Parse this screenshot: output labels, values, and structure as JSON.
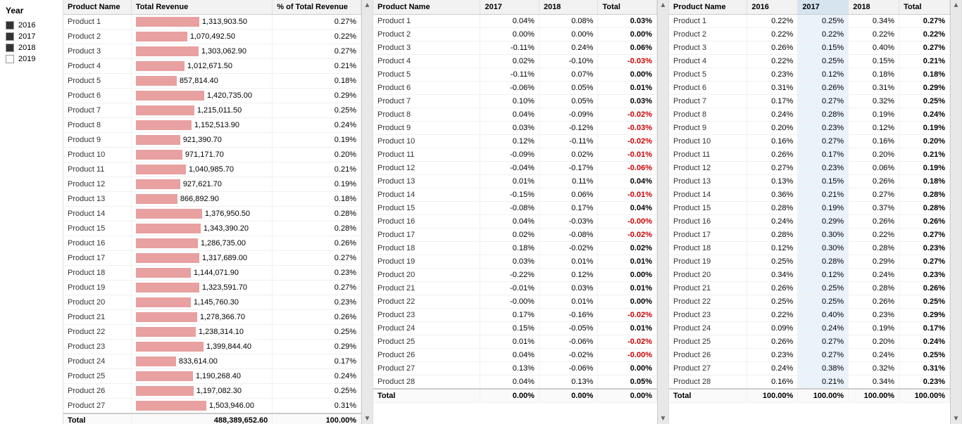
{
  "legend": {
    "title": "Year",
    "items": [
      {
        "label": "2016",
        "filled": true
      },
      {
        "label": "2017",
        "filled": true
      },
      {
        "label": "2018",
        "filled": true
      },
      {
        "label": "2019",
        "filled": false
      }
    ]
  },
  "table1": {
    "headers": [
      "Product Name",
      "Total Revenue",
      "% of Total Revenue"
    ],
    "rows": [
      {
        "name": "Product 1",
        "revenue": "1,313,903.50",
        "pct": "0.27%",
        "barW": 90
      },
      {
        "name": "Product 2",
        "revenue": "1,070,492.50",
        "pct": "0.22%",
        "barW": 73
      },
      {
        "name": "Product 3",
        "revenue": "1,303,062.90",
        "pct": "0.27%",
        "barW": 89
      },
      {
        "name": "Product 4",
        "revenue": "1,012,671.50",
        "pct": "0.21%",
        "barW": 69
      },
      {
        "name": "Product 5",
        "revenue": "857,814.40",
        "pct": "0.18%",
        "barW": 58
      },
      {
        "name": "Product 6",
        "revenue": "1,420,735.00",
        "pct": "0.29%",
        "barW": 97
      },
      {
        "name": "Product 7",
        "revenue": "1,215,011.50",
        "pct": "0.25%",
        "barW": 83
      },
      {
        "name": "Product 8",
        "revenue": "1,152,513.90",
        "pct": "0.24%",
        "barW": 79
      },
      {
        "name": "Product 9",
        "revenue": "921,390.70",
        "pct": "0.19%",
        "barW": 63
      },
      {
        "name": "Product 10",
        "revenue": "971,171.70",
        "pct": "0.20%",
        "barW": 66
      },
      {
        "name": "Product 11",
        "revenue": "1,040,985.70",
        "pct": "0.21%",
        "barW": 71
      },
      {
        "name": "Product 12",
        "revenue": "927,621.70",
        "pct": "0.19%",
        "barW": 63
      },
      {
        "name": "Product 13",
        "revenue": "866,892.90",
        "pct": "0.18%",
        "barW": 59
      },
      {
        "name": "Product 14",
        "revenue": "1,376,950.50",
        "pct": "0.28%",
        "barW": 94
      },
      {
        "name": "Product 15",
        "revenue": "1,343,390.20",
        "pct": "0.28%",
        "barW": 92
      },
      {
        "name": "Product 16",
        "revenue": "1,286,735.00",
        "pct": "0.26%",
        "barW": 88
      },
      {
        "name": "Product 17",
        "revenue": "1,317,689.00",
        "pct": "0.27%",
        "barW": 90
      },
      {
        "name": "Product 18",
        "revenue": "1,144,071.90",
        "pct": "0.23%",
        "barW": 78
      },
      {
        "name": "Product 19",
        "revenue": "1,323,591.70",
        "pct": "0.27%",
        "barW": 90
      },
      {
        "name": "Product 20",
        "revenue": "1,145,760.30",
        "pct": "0.23%",
        "barW": 78
      },
      {
        "name": "Product 21",
        "revenue": "1,278,366.70",
        "pct": "0.26%",
        "barW": 87
      },
      {
        "name": "Product 22",
        "revenue": "1,238,314.10",
        "pct": "0.25%",
        "barW": 85
      },
      {
        "name": "Product 23",
        "revenue": "1,399,844.40",
        "pct": "0.29%",
        "barW": 96
      },
      {
        "name": "Product 24",
        "revenue": "833,614.00",
        "pct": "0.17%",
        "barW": 57
      },
      {
        "name": "Product 25",
        "revenue": "1,190,268.40",
        "pct": "0.24%",
        "barW": 81
      },
      {
        "name": "Product 26",
        "revenue": "1,197,082.30",
        "pct": "0.25%",
        "barW": 82
      },
      {
        "name": "Product 27",
        "revenue": "1,503,946.00",
        "pct": "0.31%",
        "barW": 100
      }
    ],
    "total": {
      "label": "Total",
      "revenue": "488,389,652.60",
      "pct": "100.00%"
    }
  },
  "table2": {
    "headers": [
      "Product Name",
      "2017",
      "2018",
      "Total"
    ],
    "rows": [
      {
        "name": "Product 1",
        "y2017": "0.04%",
        "y2018": "0.08%",
        "total": "0.03%",
        "totalNeg": false
      },
      {
        "name": "Product 2",
        "y2017": "0.00%",
        "y2018": "0.00%",
        "total": "0.00%",
        "totalNeg": false
      },
      {
        "name": "Product 3",
        "y2017": "-0.11%",
        "y2018": "0.24%",
        "total": "0.06%",
        "totalNeg": false
      },
      {
        "name": "Product 4",
        "y2017": "0.02%",
        "y2018": "-0.10%",
        "total": "-0.03%",
        "totalNeg": true
      },
      {
        "name": "Product 5",
        "y2017": "-0.11%",
        "y2018": "0.07%",
        "total": "0.00%",
        "totalNeg": false
      },
      {
        "name": "Product 6",
        "y2017": "-0.06%",
        "y2018": "0.05%",
        "total": "0.01%",
        "totalNeg": false
      },
      {
        "name": "Product 7",
        "y2017": "0.10%",
        "y2018": "0.05%",
        "total": "0.03%",
        "totalNeg": false
      },
      {
        "name": "Product 8",
        "y2017": "0.04%",
        "y2018": "-0.09%",
        "total": "-0.02%",
        "totalNeg": true
      },
      {
        "name": "Product 9",
        "y2017": "0.03%",
        "y2018": "-0.12%",
        "total": "-0.03%",
        "totalNeg": true
      },
      {
        "name": "Product 10",
        "y2017": "0.12%",
        "y2018": "-0.11%",
        "total": "-0.02%",
        "totalNeg": true
      },
      {
        "name": "Product 11",
        "y2017": "-0.09%",
        "y2018": "0.02%",
        "total": "-0.01%",
        "totalNeg": true
      },
      {
        "name": "Product 12",
        "y2017": "-0.04%",
        "y2018": "-0.17%",
        "total": "-0.06%",
        "totalNeg": true
      },
      {
        "name": "Product 13",
        "y2017": "0.01%",
        "y2018": "0.11%",
        "total": "0.04%",
        "totalNeg": false
      },
      {
        "name": "Product 14",
        "y2017": "-0.15%",
        "y2018": "0.06%",
        "total": "-0.01%",
        "totalNeg": true
      },
      {
        "name": "Product 15",
        "y2017": "-0.08%",
        "y2018": "0.17%",
        "total": "0.04%",
        "totalNeg": false
      },
      {
        "name": "Product 16",
        "y2017": "0.04%",
        "y2018": "-0.03%",
        "total": "-0.00%",
        "totalNeg": true
      },
      {
        "name": "Product 17",
        "y2017": "0.02%",
        "y2018": "-0.08%",
        "total": "-0.02%",
        "totalNeg": true
      },
      {
        "name": "Product 18",
        "y2017": "0.18%",
        "y2018": "-0.02%",
        "total": "0.02%",
        "totalNeg": false
      },
      {
        "name": "Product 19",
        "y2017": "0.03%",
        "y2018": "0.01%",
        "total": "0.01%",
        "totalNeg": false
      },
      {
        "name": "Product 20",
        "y2017": "-0.22%",
        "y2018": "0.12%",
        "total": "0.00%",
        "totalNeg": false
      },
      {
        "name": "Product 21",
        "y2017": "-0.01%",
        "y2018": "0.03%",
        "total": "0.01%",
        "totalNeg": false
      },
      {
        "name": "Product 22",
        "y2017": "-0.00%",
        "y2018": "0.01%",
        "total": "0.00%",
        "totalNeg": false
      },
      {
        "name": "Product 23",
        "y2017": "0.17%",
        "y2018": "-0.16%",
        "total": "-0.02%",
        "totalNeg": true
      },
      {
        "name": "Product 24",
        "y2017": "0.15%",
        "y2018": "-0.05%",
        "total": "0.01%",
        "totalNeg": false
      },
      {
        "name": "Product 25",
        "y2017": "0.01%",
        "y2018": "-0.06%",
        "total": "-0.02%",
        "totalNeg": true
      },
      {
        "name": "Product 26",
        "y2017": "0.04%",
        "y2018": "-0.02%",
        "total": "-0.00%",
        "totalNeg": true
      },
      {
        "name": "Product 27",
        "y2017": "0.13%",
        "y2018": "-0.06%",
        "total": "0.00%",
        "totalNeg": false
      },
      {
        "name": "Product 28",
        "y2017": "0.04%",
        "y2018": "0.13%",
        "total": "0.05%",
        "totalNeg": false
      }
    ],
    "total": {
      "label": "Total",
      "y2017": "0.00%",
      "y2018": "0.00%",
      "total": "0.00%"
    }
  },
  "table3": {
    "headers": [
      "Product Name",
      "2016",
      "2017",
      "2018",
      "Total"
    ],
    "sortedCol": "2017",
    "rows": [
      {
        "name": "Product 1",
        "y2016": "0.22%",
        "y2017": "0.25%",
        "y2018": "0.34%",
        "total": "0.27%"
      },
      {
        "name": "Product 2",
        "y2016": "0.22%",
        "y2017": "0.22%",
        "y2018": "0.22%",
        "total": "0.22%"
      },
      {
        "name": "Product 3",
        "y2016": "0.26%",
        "y2017": "0.15%",
        "y2018": "0.40%",
        "total": "0.27%"
      },
      {
        "name": "Product 4",
        "y2016": "0.22%",
        "y2017": "0.25%",
        "y2018": "0.15%",
        "total": "0.21%"
      },
      {
        "name": "Product 5",
        "y2016": "0.23%",
        "y2017": "0.12%",
        "y2018": "0.18%",
        "total": "0.18%"
      },
      {
        "name": "Product 6",
        "y2016": "0.31%",
        "y2017": "0.26%",
        "y2018": "0.31%",
        "total": "0.29%"
      },
      {
        "name": "Product 7",
        "y2016": "0.17%",
        "y2017": "0.27%",
        "y2018": "0.32%",
        "total": "0.25%"
      },
      {
        "name": "Product 8",
        "y2016": "0.24%",
        "y2017": "0.28%",
        "y2018": "0.19%",
        "total": "0.24%"
      },
      {
        "name": "Product 9",
        "y2016": "0.20%",
        "y2017": "0.23%",
        "y2018": "0.12%",
        "total": "0.19%"
      },
      {
        "name": "Product 10",
        "y2016": "0.16%",
        "y2017": "0.27%",
        "y2018": "0.16%",
        "total": "0.20%"
      },
      {
        "name": "Product 11",
        "y2016": "0.26%",
        "y2017": "0.17%",
        "y2018": "0.20%",
        "total": "0.21%"
      },
      {
        "name": "Product 12",
        "y2016": "0.27%",
        "y2017": "0.23%",
        "y2018": "0.06%",
        "total": "0.19%"
      },
      {
        "name": "Product 13",
        "y2016": "0.13%",
        "y2017": "0.15%",
        "y2018": "0.26%",
        "total": "0.18%"
      },
      {
        "name": "Product 14",
        "y2016": "0.36%",
        "y2017": "0.21%",
        "y2018": "0.27%",
        "total": "0.28%"
      },
      {
        "name": "Product 15",
        "y2016": "0.28%",
        "y2017": "0.19%",
        "y2018": "0.37%",
        "total": "0.28%"
      },
      {
        "name": "Product 16",
        "y2016": "0.24%",
        "y2017": "0.29%",
        "y2018": "0.26%",
        "total": "0.26%"
      },
      {
        "name": "Product 17",
        "y2016": "0.28%",
        "y2017": "0.30%",
        "y2018": "0.22%",
        "total": "0.27%"
      },
      {
        "name": "Product 18",
        "y2016": "0.12%",
        "y2017": "0.30%",
        "y2018": "0.28%",
        "total": "0.23%"
      },
      {
        "name": "Product 19",
        "y2016": "0.25%",
        "y2017": "0.28%",
        "y2018": "0.29%",
        "total": "0.27%"
      },
      {
        "name": "Product 20",
        "y2016": "0.34%",
        "y2017": "0.12%",
        "y2018": "0.24%",
        "total": "0.23%"
      },
      {
        "name": "Product 21",
        "y2016": "0.26%",
        "y2017": "0.25%",
        "y2018": "0.28%",
        "total": "0.26%"
      },
      {
        "name": "Product 22",
        "y2016": "0.25%",
        "y2017": "0.25%",
        "y2018": "0.26%",
        "total": "0.25%"
      },
      {
        "name": "Product 23",
        "y2016": "0.22%",
        "y2017": "0.40%",
        "y2018": "0.23%",
        "total": "0.29%"
      },
      {
        "name": "Product 24",
        "y2016": "0.09%",
        "y2017": "0.24%",
        "y2018": "0.19%",
        "total": "0.17%"
      },
      {
        "name": "Product 25",
        "y2016": "0.26%",
        "y2017": "0.27%",
        "y2018": "0.20%",
        "total": "0.24%"
      },
      {
        "name": "Product 26",
        "y2016": "0.23%",
        "y2017": "0.27%",
        "y2018": "0.24%",
        "total": "0.25%"
      },
      {
        "name": "Product 27",
        "y2016": "0.24%",
        "y2017": "0.38%",
        "y2018": "0.32%",
        "total": "0.31%"
      },
      {
        "name": "Product 28",
        "y2016": "0.16%",
        "y2017": "0.21%",
        "y2018": "0.34%",
        "total": "0.23%"
      }
    ],
    "total": {
      "label": "Total",
      "y2016": "100.00%",
      "y2017": "100.00%",
      "y2018": "100.00%",
      "total": "100.00%"
    }
  }
}
